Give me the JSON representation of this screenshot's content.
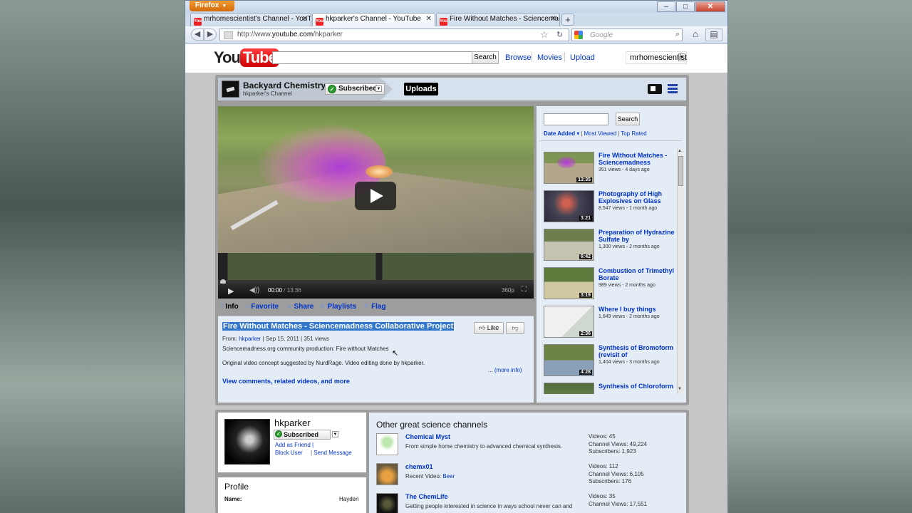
{
  "browser": {
    "app_button": "Firefox",
    "tabs": [
      {
        "title": "mrhomescientist's Channel - YouTube"
      },
      {
        "title": "hkparker's Channel - YouTube"
      },
      {
        "title": "Fire Without Matches - Sciencemadn..."
      }
    ],
    "new_tab": "+",
    "url_prefix": "http://www.",
    "url_domain": "youtube.com",
    "url_path": "/hkparker",
    "search_placeholder": "Google"
  },
  "youtube": {
    "logo_you": "You",
    "logo_tube": "Tube",
    "search_button": "Search",
    "nav": [
      "Browse",
      "Movies",
      "Upload"
    ],
    "username": "mrhomescientist"
  },
  "channel": {
    "name": "Backyard Chemistry",
    "subtitle": "hkparker's Channel",
    "subscribed_label": "Subscribed",
    "uploads_label": "Uploads"
  },
  "player": {
    "time_current": "00:00",
    "time_total": "/ 13:36",
    "quality": "360p"
  },
  "actions": [
    "Info",
    "Favorite",
    "Share",
    "Playlists",
    "Flag"
  ],
  "video": {
    "title": "Fire Without Matches - Sciencemadness Collaborative Project",
    "from_label": "From:",
    "author": "hkparker",
    "date": "Sep 15, 2011",
    "views": "351 views",
    "desc1": "Sciencemadness.org community production: Fire without Matches",
    "desc2": "Original video concept suggested by NurdRage. Video editing done by hkparker.",
    "more_info": "(more info)",
    "view_comments": "View comments, related videos, and more",
    "like_label": "Like"
  },
  "sidebar": {
    "search_button": "Search",
    "sort_selected": "Date Added",
    "sort_most_viewed": "Most Viewed",
    "sort_top_rated": "Top Rated",
    "videos": [
      {
        "title": "Fire Without Matches - Sciencemadness",
        "meta": "351 views - 4 days ago",
        "duration": "13:35"
      },
      {
        "title": "Photography of High Explosives on Glass",
        "meta": "8,547 views - 1 month ago",
        "duration": "3:21"
      },
      {
        "title": "Preparation of Hydrazine Sulfate by",
        "meta": "1,300 views - 2 months ago",
        "duration": "6:42"
      },
      {
        "title": "Combustion of Trimethyl Borate",
        "meta": "989 views - 2 months ago",
        "duration": "3:19"
      },
      {
        "title": "Where I buy things",
        "meta": "1,649 views - 2 months ago",
        "duration": "2:36"
      },
      {
        "title": "Synthesis of Bromoform (revisit of",
        "meta": "1,404 views - 3 months ago",
        "duration": "4:28"
      },
      {
        "title": "Synthesis of Chloroform",
        "meta": "",
        "duration": ""
      }
    ]
  },
  "profile": {
    "name": "hkparker",
    "subscribed_label": "Subscribed",
    "add_friend": "Add as Friend",
    "block_user": "Block User",
    "send_message": "Send Message",
    "section_heading": "Profile",
    "name_label": "Name:",
    "name_value": "Hayden"
  },
  "other_channels": {
    "heading": "Other great science channels",
    "channels": [
      {
        "name": "Chemical Myst",
        "desc": "From simple home chemistry to advanced chemical synthesis.",
        "desc_link": "",
        "stats": [
          "Videos: 45",
          "Channel Views: 49,224",
          "Subscribers: 1,923"
        ]
      },
      {
        "name": "chemx01",
        "desc": "Recent Video:",
        "desc_link": "Beer",
        "stats": [
          "Videos: 112",
          "Channel Views: 6,105",
          "Subscribers: 176"
        ]
      },
      {
        "name": "The ChemLife",
        "desc": "Getting people interested in science in ways school never can and",
        "desc_link": "",
        "stats": [
          "Videos: 35",
          "Channel Views: 17,551",
          ""
        ]
      }
    ]
  },
  "colors": {
    "yt_red": "#cc0000",
    "link": "#0033cc",
    "firefox_orange": "#e8820f",
    "selection": "#3377cc"
  }
}
